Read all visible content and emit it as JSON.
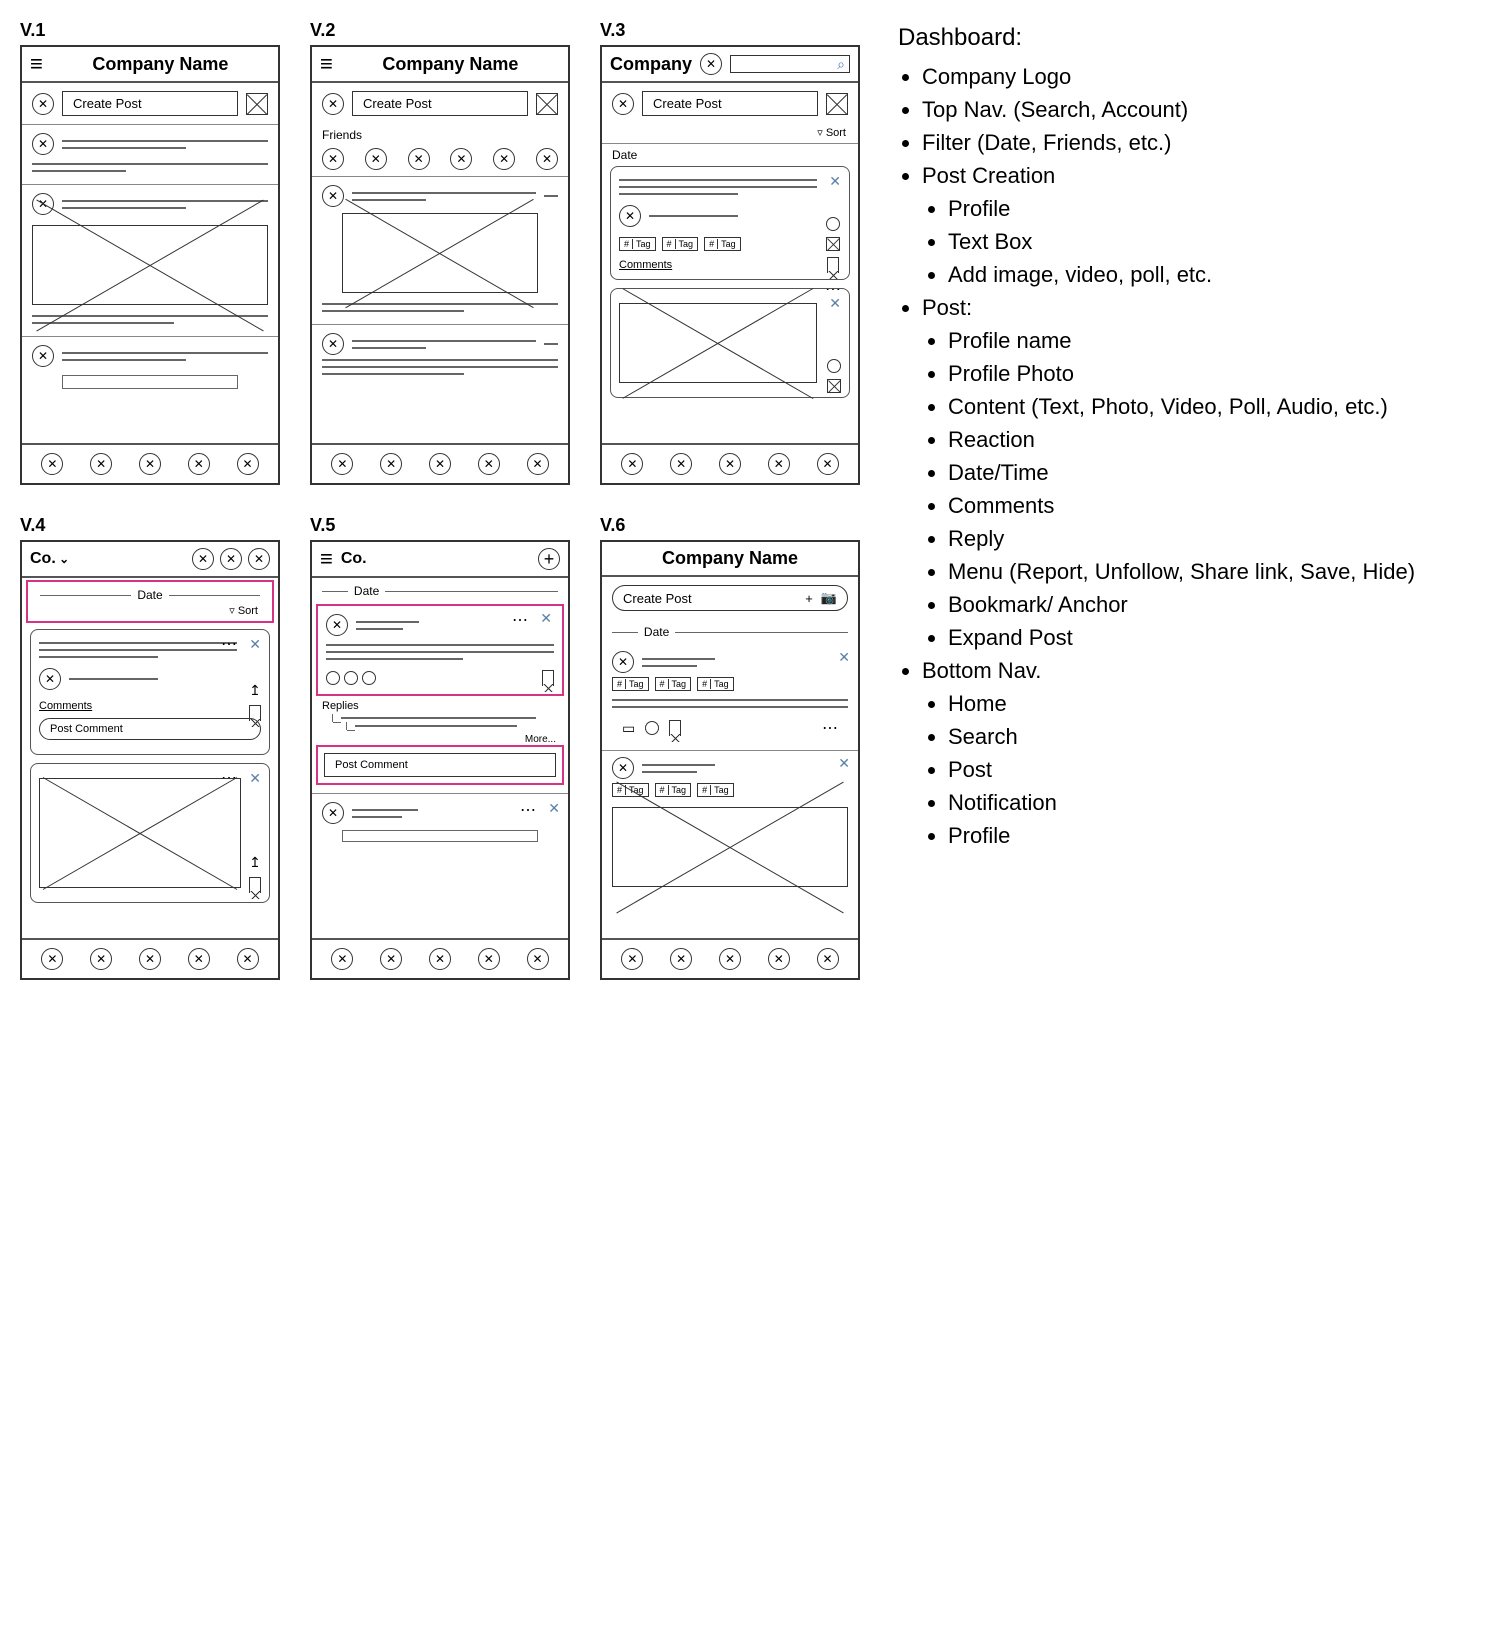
{
  "labels": {
    "v1": "V.1",
    "v2": "V.2",
    "v3": "V.3",
    "v4": "V.4",
    "v5": "V.5",
    "v6": "V.6"
  },
  "common": {
    "company_full": "Company Name",
    "company_short": "Company",
    "co": "Co.",
    "create_post": "Create Post",
    "sort": "Sort",
    "date": "Date",
    "friends": "Friends",
    "comments": "Comments",
    "post_comment": "Post Comment",
    "replies": "Replies",
    "more": "More...",
    "tag": "Tag"
  },
  "v6": {
    "plus": "+",
    "cam": "⎙"
  },
  "notes": {
    "title": "Dashboard:",
    "items": [
      "Company Logo",
      "Top Nav. (Search, Account)",
      "Filter (Date, Friends, etc.)",
      "Post Creation",
      "Post:",
      "Bottom Nav."
    ],
    "post_creation": [
      "Profile",
      "Text Box",
      "Add image, video, poll, etc."
    ],
    "post_items": [
      "Profile name",
      "Profile Photo",
      "Content (Text, Photo, Video, Poll, Audio, etc.)",
      "Reaction",
      "Date/Time",
      "Comments",
      "Reply",
      "Menu (Report, Unfollow, Share link, Save, Hide)",
      "Bookmark/ Anchor",
      "Expand Post"
    ],
    "bottom_nav": [
      "Home",
      "Search",
      "Post",
      "Notification",
      "Profile"
    ]
  }
}
